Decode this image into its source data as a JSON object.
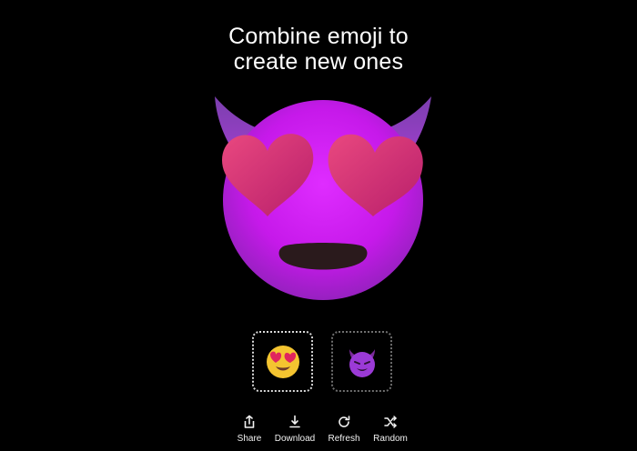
{
  "header": {
    "title_line1": "Combine emoji to",
    "title_line2": "create new ones"
  },
  "result": {
    "emoji": "smiling-face-with-heart-eyes + smiling-face-with-horns"
  },
  "inputs": [
    {
      "emoji": "😍",
      "name": "smiling-face-with-heart-eyes"
    },
    {
      "emoji": "😈",
      "name": "smiling-face-with-horns"
    }
  ],
  "actions": [
    {
      "label": "Share",
      "icon": "share-icon"
    },
    {
      "label": "Download",
      "icon": "download-icon"
    },
    {
      "label": "Refresh",
      "icon": "refresh-icon"
    },
    {
      "label": "Random",
      "icon": "shuffle-icon"
    }
  ],
  "colors": {
    "background": "#000000",
    "face_purple": "#c81bf0",
    "horn_purple": "#8a3fb2",
    "heart_pink": "#d3367a",
    "mouth": "#2a1a1c"
  }
}
